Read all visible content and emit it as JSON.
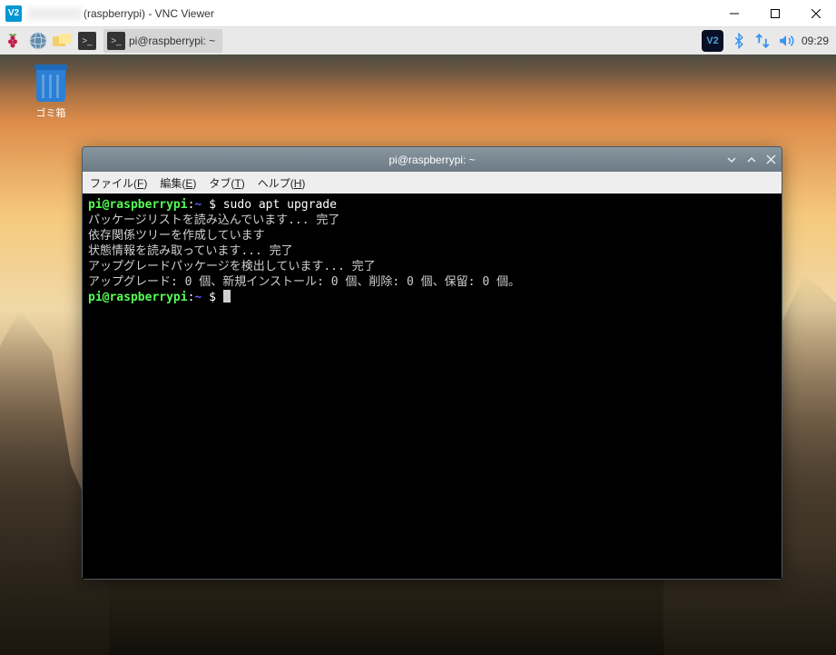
{
  "windows_title": "(raspberrypi) - VNC Viewer",
  "desktop": {
    "trash_label": "ゴミ箱"
  },
  "taskbar": {
    "task_window_title": "pi@raspberrypi: ~",
    "clock": "09:29"
  },
  "terminal": {
    "title": "pi@raspberrypi: ~",
    "menu": {
      "file": "ファイル(F)",
      "edit": "編集(E)",
      "tabs": "タブ(T)",
      "help": "ヘルプ(H)"
    },
    "prompt_user": "pi@raspberrypi",
    "prompt_path": "~",
    "prompt_sym": "$",
    "command": "sudo apt upgrade",
    "lines": [
      "パッケージリストを読み込んでいます... 完了",
      "依存関係ツリーを作成しています",
      "状態情報を読み取っています... 完了",
      "アップグレードパッケージを検出しています... 完了",
      "アップグレード: 0 個、新規インストール: 0 個、削除: 0 個、保留: 0 個。"
    ]
  }
}
